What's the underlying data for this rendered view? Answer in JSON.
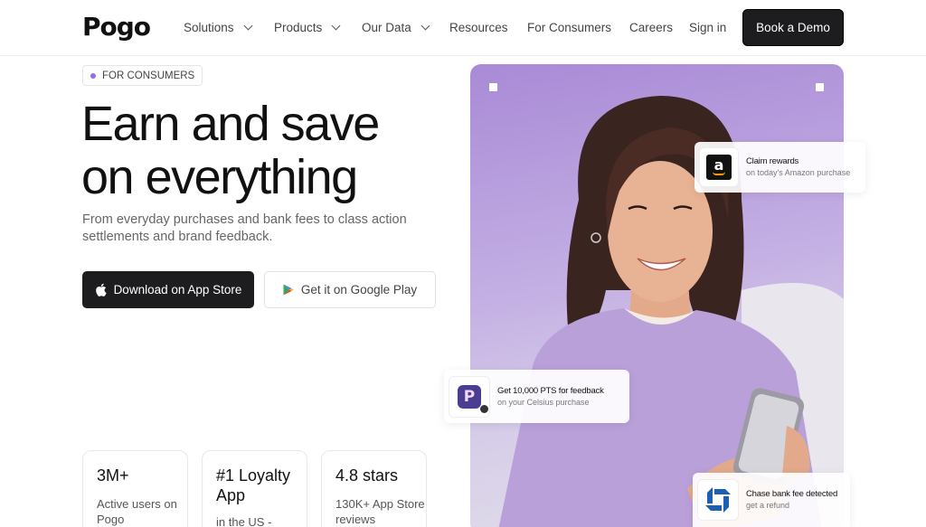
{
  "nav": {
    "logo": "Pogo",
    "items": [
      {
        "label": "Solutions",
        "has_menu": true
      },
      {
        "label": "Products",
        "has_menu": true
      },
      {
        "label": "Our Data",
        "has_menu": true
      },
      {
        "label": "Resources",
        "has_menu": false
      },
      {
        "label": "For Consumers",
        "has_menu": false
      },
      {
        "label": "Careers",
        "has_menu": false
      },
      {
        "label": "Sign in",
        "has_menu": false
      }
    ],
    "cta": "Book a Demo"
  },
  "hero": {
    "badge": "FOR CONSUMERS",
    "headline_line1": "Earn and save",
    "headline_line2": "on everything",
    "subhead": "From everyday purchases and bank fees to class action settlements and brand feedback.",
    "app_store_label": "Download on App Store",
    "google_play_label": "Get it on Google Play"
  },
  "stats": [
    {
      "big": "3M+",
      "small": "Active users on Pogo"
    },
    {
      "big": "#1 Loyalty App",
      "small": "in the US -"
    },
    {
      "big": "4.8 stars",
      "small": "130K+ App Store reviews"
    }
  ],
  "cards": {
    "amazon": {
      "title": "Claim rewards",
      "sub": "on today's Amazon purchase",
      "icon": "amazon-logo"
    },
    "celsius": {
      "title": "Get 10,000 PTS for feedback",
      "sub": "on your Celsius purchase",
      "icon": "pogo-app-logo"
    },
    "chase": {
      "title": "Chase bank fee detected",
      "sub": "get a refund",
      "icon": "chase-logo"
    }
  },
  "colors": {
    "accent": "#8f6cf0",
    "dark_button": "#1d1d1f",
    "photo_bg": "#b9a2df"
  }
}
